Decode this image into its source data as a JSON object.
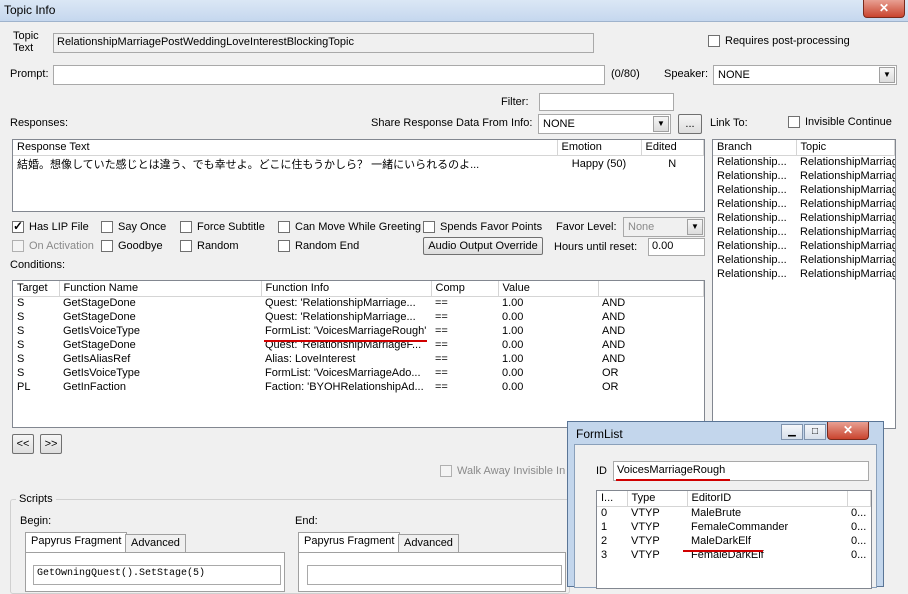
{
  "window": {
    "title": "Topic Info",
    "close_label": "✕"
  },
  "topic": {
    "label_line1": "Topic",
    "label_line2": "Text",
    "value": "RelationshipMarriagePostWeddingLoveInterestBlockingTopic"
  },
  "requires_post_processing": {
    "label": "Requires post-processing",
    "checked": false
  },
  "prompt": {
    "label": "Prompt:",
    "value": "",
    "count": "(0/80)"
  },
  "speaker": {
    "label": "Speaker:",
    "value": "NONE"
  },
  "filter": {
    "label": "Filter:",
    "value": ""
  },
  "responses_label": "Responses:",
  "share": {
    "label": "Share Response Data From Info:",
    "value": "NONE",
    "browse_label": "..."
  },
  "link_to": {
    "label": "Link To:",
    "invisible_continue_label": "Invisible Continue"
  },
  "responses_table": {
    "headers": [
      "Response Text",
      "Emotion",
      "Edited"
    ],
    "rows": [
      {
        "text": "結婚。想像していた感じとは違う、でも幸せよ。どこに住もうかしら？ 一緒にいられるのよ...",
        "emotion": "Happy (50)",
        "edited": "N"
      }
    ]
  },
  "link_table": {
    "headers": [
      "Branch",
      "Topic"
    ],
    "rows": [
      [
        "Relationship...",
        "RelationshipMarriag"
      ],
      [
        "Relationship...",
        "RelationshipMarriag"
      ],
      [
        "Relationship...",
        "RelationshipMarriag"
      ],
      [
        "Relationship...",
        "RelationshipMarriag"
      ],
      [
        "Relationship...",
        "RelationshipMarriag"
      ],
      [
        "Relationship...",
        "RelationshipMarriag"
      ],
      [
        "Relationship...",
        "RelationshipMarriag"
      ],
      [
        "Relationship...",
        "RelationshipMarriag"
      ],
      [
        "Relationship...",
        "RelationshipMarriag"
      ]
    ]
  },
  "options": {
    "has_lip_file": "Has LIP File",
    "say_once": "Say Once",
    "force_subtitle": "Force Subtitle",
    "can_move": "Can Move While Greeting",
    "spends_favor": "Spends Favor Points",
    "favor_level_label": "Favor Level:",
    "favor_level_value": "None",
    "on_activation": "On Activation",
    "goodbye": "Goodbye",
    "random": "Random",
    "random_end": "Random End",
    "audio_override": "Audio Output Override",
    "hours_label": "Hours until reset:",
    "hours_value": "0.00"
  },
  "conditions": {
    "label": "Conditions:",
    "headers": [
      "Target",
      "Function Name",
      "Function Info",
      "Comp",
      "Value",
      ""
    ],
    "rows": [
      [
        "S",
        "GetStageDone",
        "Quest: 'RelationshipMarriage...",
        "==",
        "1.00",
        "AND"
      ],
      [
        "S",
        "GetStageDone",
        "Quest: 'RelationshipMarriage...",
        "==",
        "0.00",
        "AND"
      ],
      [
        "S",
        "GetIsVoiceType",
        "FormList: 'VoicesMarriageRough'",
        "==",
        "1.00",
        "AND"
      ],
      [
        "S",
        "GetStageDone",
        "Quest: 'RelationshipMarriageF...",
        "==",
        "0.00",
        "AND"
      ],
      [
        "S",
        "GetIsAliasRef",
        "Alias: LoveInterest",
        "==",
        "1.00",
        "AND"
      ],
      [
        "S",
        "GetIsVoiceType",
        "FormList: 'VoicesMarriageAdo...",
        "==",
        "0.00",
        "OR"
      ],
      [
        "PL",
        "GetInFaction",
        "Faction: 'BYOHRelationshipAd...",
        "==",
        "0.00",
        "OR"
      ]
    ]
  },
  "nav": {
    "prev": "<<",
    "next": ">>"
  },
  "walk_away": "Walk Away Invisible In M",
  "scripts": {
    "label": "Scripts",
    "begin_label": "Begin:",
    "end_label": "End:",
    "tab_fragment": "Papyrus Fragment",
    "tab_advanced": "Advanced",
    "begin_code": "GetOwningQuest().SetStage(5)",
    "end_code": ""
  },
  "formlist": {
    "title": "FormList",
    "id_label": "ID",
    "id_value": "VoicesMarriageRough",
    "headers": [
      "I...",
      "Type",
      "EditorID",
      ""
    ],
    "rows": [
      [
        "0",
        "VTYP",
        "MaleBrute",
        "0..."
      ],
      [
        "1",
        "VTYP",
        "FemaleCommander",
        "0..."
      ],
      [
        "2",
        "VTYP",
        "MaleDarkElf",
        "0..."
      ],
      [
        "3",
        "VTYP",
        "FemaleDarkElf",
        "0..."
      ]
    ],
    "minimize": "▁",
    "maximize": "□",
    "close": "✕"
  },
  "colors": {
    "highlight_underline": "#d00000"
  }
}
